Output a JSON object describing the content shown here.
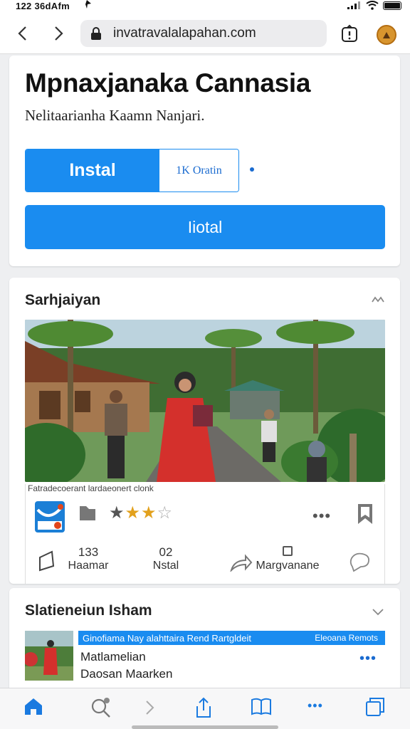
{
  "status_bar": {
    "time": "122 36dAfm"
  },
  "browser": {
    "url": "invatravalalapahan.com"
  },
  "app": {
    "title": "Mpnaxjanaka Cannasia",
    "subtitle": "Nelitaarianha Kaamn Nanjari.",
    "install_label": "Instal",
    "secondary_label": "1K Oratin",
    "wide_button_label": "Iiotal"
  },
  "section1": {
    "title": "Sarhjaiyan",
    "caption": "Fatradecoerant lardaeonert clonk",
    "rating": 3,
    "stats": [
      {
        "number": "133",
        "label": "Haamar"
      },
      {
        "number": "02",
        "label": "Nstal"
      },
      {
        "number": "",
        "label": "Margvanane"
      }
    ]
  },
  "section2": {
    "title": "Slatieneiun Isham",
    "banner_text": "Ginofiama Nay alahttaira Rend Rartgldeit",
    "banner_right": "Eleoana Remots",
    "line1": "Matlamelian",
    "line2": "Daosan Maarken"
  },
  "icons": {
    "back": "chevron-left-icon",
    "forward": "chevron-right-icon",
    "lock": "lock-icon",
    "share": "share-icon",
    "home": "home-icon",
    "search": "search-icon",
    "bookmarks": "book-icon",
    "tabs": "tabs-icon"
  },
  "colors": {
    "accent": "#1a8cf0",
    "star": "#e2a11d"
  }
}
